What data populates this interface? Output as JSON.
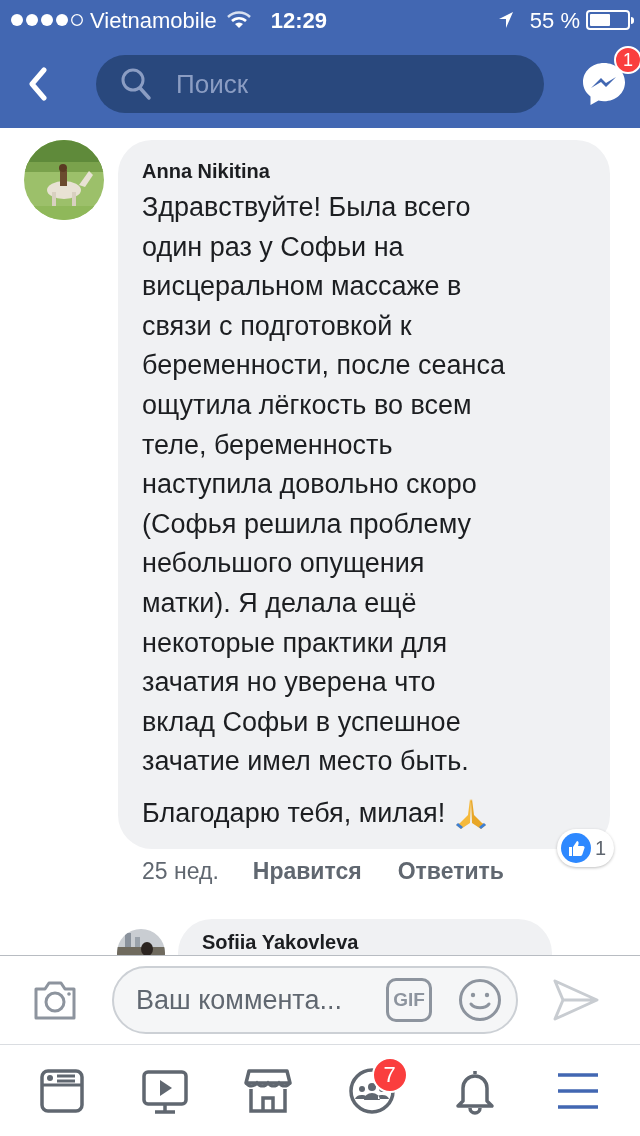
{
  "status_bar": {
    "carrier": "Vietnamobile",
    "time": "12:29",
    "battery": "55 %"
  },
  "nav_bar": {
    "search": {
      "placeholder": "Поиск"
    },
    "messenger_badge": "1"
  },
  "comments": [
    {
      "author": "Anna Nikitina",
      "text": "Здравствуйте! Была всего\nодин раз у Софьи на\nвисцеральном массаже в\nсвязи с подготовкой к\nбеременности, после сеанса\nощутила лёгкость во всем\nтеле, беременность\nнаступила довольно скоро\n(Софья решила проблему\nнебольшого опущения\nматки). Я делала ещё\nнекоторые практики для\nзачатия но уверена что\nвклад Софьи в успешное\nзачатие имел место быть.",
      "closing": "Благодарю тебя, милая!",
      "time": "25 нед.",
      "actions": [
        "Нравится",
        "Ответить"
      ],
      "likes": "1"
    },
    {
      "author": "Sofiia Yakovleva"
    }
  ],
  "composer": {
    "placeholder": "Ваш коммента...",
    "gif": "GIF"
  },
  "tabs": [
    {
      "kind": "news",
      "selected": false
    },
    {
      "kind": "video",
      "selected": false
    },
    {
      "kind": "market",
      "selected": false
    },
    {
      "kind": "groups",
      "selected": false,
      "badge": "7"
    },
    {
      "kind": "bell",
      "selected": false
    },
    {
      "kind": "menu",
      "selected": true
    }
  ]
}
